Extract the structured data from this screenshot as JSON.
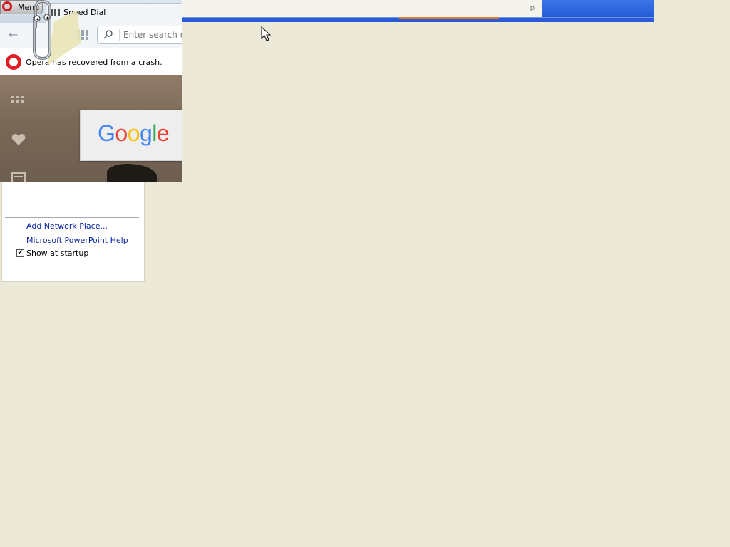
{
  "browser": {
    "menu_label": "Menu",
    "tab_title": "Speed Dial",
    "address_placeholder": "Enter search or",
    "crash_message": "Opera has recovered from a crash.",
    "google_letters": [
      "G",
      "o",
      "o",
      "g",
      "l",
      "e"
    ]
  },
  "top_strip": {
    "letter": "p"
  },
  "task_pane": {
    "links": [
      "Add Network Place...",
      "Microsoft PowerPoint Help"
    ],
    "show_at_startup_label": "Show at startup",
    "show_at_startup_checked": true
  },
  "colors": {
    "desktop": "#ece9d8",
    "taskbar_blue": "#2a5bd7",
    "opera_red": "#e01f25",
    "link_blue": "#0a24a0"
  },
  "icons": [
    "opera-logo-icon",
    "speed-dial-grid-icon",
    "back-arrow-icon",
    "search-icon",
    "heart-icon",
    "news-icon",
    "clippy-icon",
    "mouse-cursor-icon"
  ]
}
